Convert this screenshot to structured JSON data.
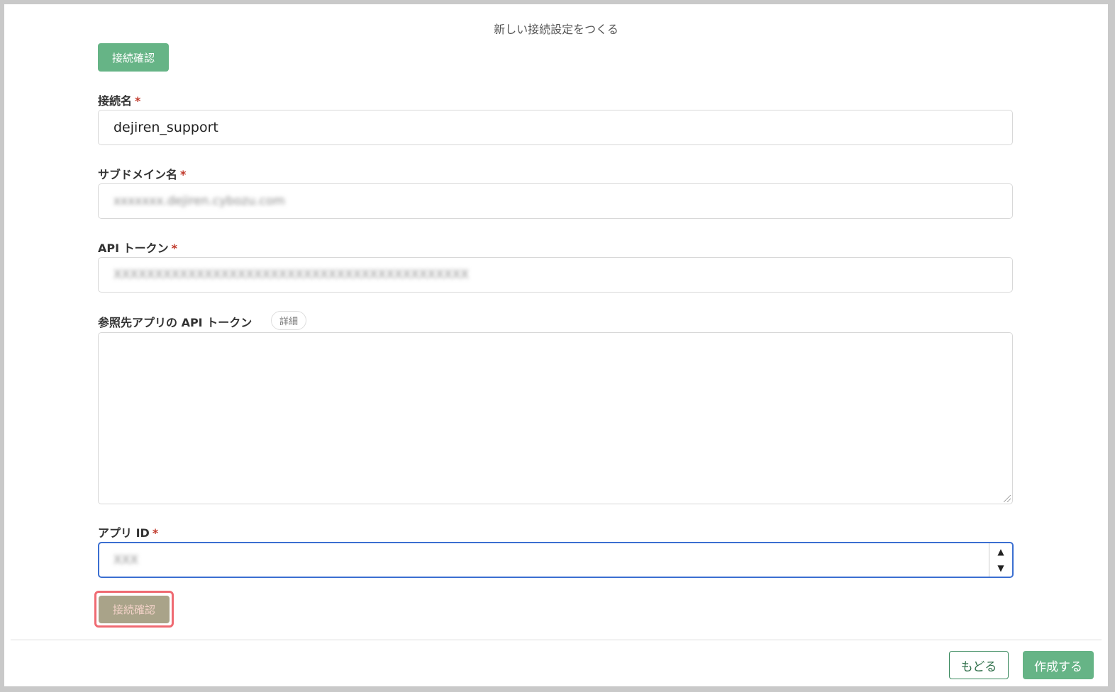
{
  "dialog": {
    "title": "新しい接続設定をつくる",
    "connect_check_top": "接続確認",
    "connect_check_bottom": "接続確認"
  },
  "form": {
    "connection_name": {
      "label": "接続名",
      "required_mark": "*",
      "value": "dejiren_support"
    },
    "subdomain": {
      "label": "サブドメイン名",
      "required_mark": "*",
      "value": "xxxxxxx.dejiren.cybozu.com"
    },
    "api_token": {
      "label": "API トークン",
      "required_mark": "*",
      "value": "XXXXXXXXXXXXXXXXXXXXXXXXXXXXXXXXXXXXXXXXXXX"
    },
    "ref_api_token": {
      "label": "参照先アプリの API トークン",
      "detail_badge": "詳細",
      "value": ""
    },
    "app_id": {
      "label": "アプリ ID",
      "required_mark": "*",
      "value": "XXX"
    }
  },
  "footer": {
    "back_label": "もどる",
    "create_label": "作成する"
  },
  "colors": {
    "primary_green": "#66b486",
    "focus_blue": "#3b6fd1",
    "highlight_red": "#ef6a72",
    "required_red": "#c0392b"
  },
  "icons": {
    "spinner_up": "▲",
    "spinner_down": "▼"
  }
}
